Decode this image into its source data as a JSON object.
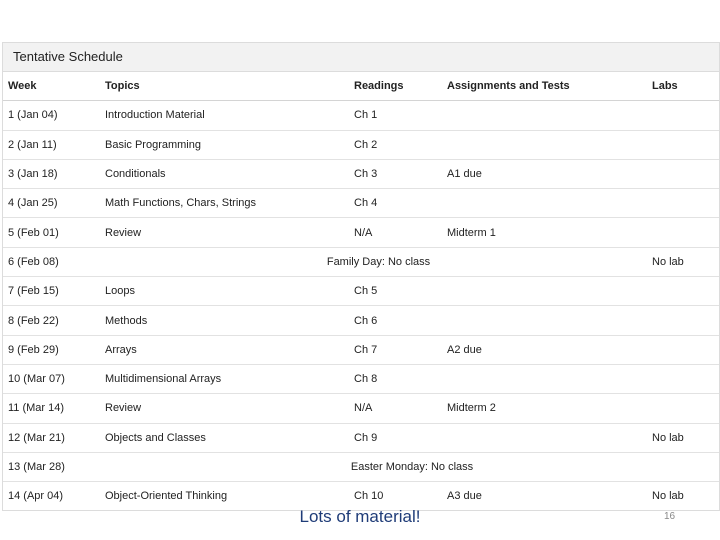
{
  "panel": {
    "title": "Tentative Schedule"
  },
  "columns": [
    "Week",
    "Topics",
    "Readings",
    "Assignments and Tests",
    "Labs"
  ],
  "rows": [
    {
      "week": "1 (Jan 04)",
      "topic": "Introduction Material",
      "reading": "Ch 1",
      "assign": "",
      "lab": ""
    },
    {
      "week": "2 (Jan 11)",
      "topic": "Basic Programming",
      "reading": "Ch 2",
      "assign": "",
      "lab": ""
    },
    {
      "week": "3 (Jan 18)",
      "topic": "Conditionals",
      "reading": "Ch 3",
      "assign": "A1 due",
      "lab": ""
    },
    {
      "week": "4 (Jan 25)",
      "topic": "Math Functions, Chars, Strings",
      "reading": "Ch 4",
      "assign": "",
      "lab": ""
    },
    {
      "week": "5 (Feb 01)",
      "topic": "Review",
      "reading": "N/A",
      "assign": "Midterm 1",
      "lab": ""
    },
    {
      "week": "6 (Feb 08)",
      "span": "Family Day: No class",
      "lab": "No lab"
    },
    {
      "week": "7 (Feb 15)",
      "topic": "Loops",
      "reading": "Ch 5",
      "assign": "",
      "lab": ""
    },
    {
      "week": "8 (Feb 22)",
      "topic": "Methods",
      "reading": "Ch 6",
      "assign": "",
      "lab": ""
    },
    {
      "week": "9 (Feb 29)",
      "topic": "Arrays",
      "reading": "Ch 7",
      "assign": "A2 due",
      "lab": ""
    },
    {
      "week": "10 (Mar 07)",
      "topic": "Multidimensional Arrays",
      "reading": "Ch 8",
      "assign": "",
      "lab": ""
    },
    {
      "week": "11 (Mar 14)",
      "topic": "Review",
      "reading": "N/A",
      "assign": "Midterm 2",
      "lab": ""
    },
    {
      "week": "12 (Mar 21)",
      "topic": "Objects and Classes",
      "reading": "Ch 9",
      "assign": "",
      "lab": "No lab"
    },
    {
      "week": "13 (Mar 28)",
      "span": "Easter Monday: No class",
      "spanFull": true,
      "lab": ""
    },
    {
      "week": "14 (Apr 04)",
      "topic": "Object-Oriented Thinking",
      "reading": "Ch 10",
      "assign": "A3 due",
      "lab": "No lab"
    }
  ],
  "footer": {
    "caption": "Lots of material!",
    "page": "16"
  }
}
